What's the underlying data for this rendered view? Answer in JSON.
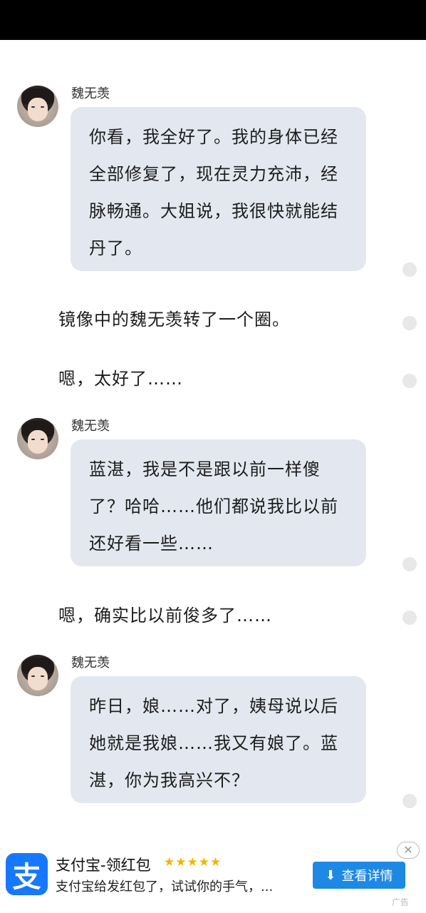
{
  "messages": [
    {
      "sender": "魏无羡",
      "text": "你看，我全好了。我的身体已经全部修复了，现在灵力充沛，经脉畅通。大姐说，我很快就能结丹了。"
    },
    {
      "narration": "镜像中的魏无羡转了一个圈。"
    },
    {
      "narration": "嗯，太好了……"
    },
    {
      "sender": "魏无羡",
      "text": "蓝湛，我是不是跟以前一样傻了？哈哈……他们都说我比以前还好看一些……"
    },
    {
      "narration": "嗯，确实比以前俊多了……"
    },
    {
      "sender": "魏无羡",
      "text": "昨日，娘……对了，姨母说以后她就是我娘……我又有娘了。蓝湛，你为我高兴不？"
    }
  ],
  "ad": {
    "title": "支付宝-领红包",
    "stars": "★★★★★",
    "description": "支付宝给发红包了，试试你的手气，...",
    "button_label": "查看详情",
    "tag": "广告",
    "logo_char": "支",
    "close_symbol": "✕",
    "download_icon": "⬇"
  },
  "colors": {
    "bubble": "#e3e8f0",
    "ad_button": "#1e88e5",
    "alipay_blue": "#1677ff"
  }
}
